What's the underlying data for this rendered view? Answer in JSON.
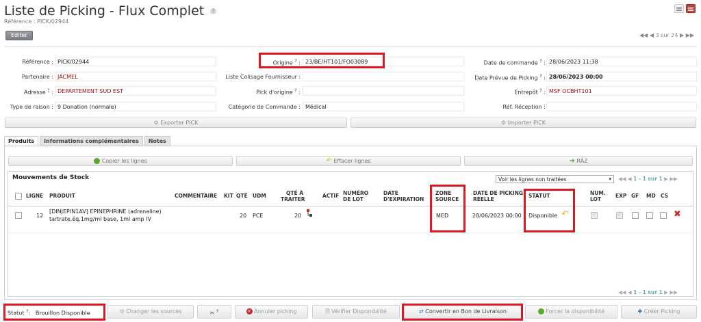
{
  "header": {
    "title": "Liste de Picking - Flux Complet",
    "title_help": "?",
    "reference_line": "Référence : PICK/02944",
    "edit_label": "Editer",
    "pager": "◀◀ ◀ 3 sur 24 ▶ ▶▶"
  },
  "form": {
    "reference": {
      "label": "Référence :",
      "value": "PICK/02944"
    },
    "partenaire": {
      "label": "Partenaire :",
      "value": "JACMEL"
    },
    "adresse": {
      "label": "Adresse",
      "help": "?",
      "sep": ":",
      "value": "DEPARTEMENT SUD EST"
    },
    "type_raison": {
      "label": "Type de raison :",
      "value": "9 Donation (normale)"
    },
    "origine": {
      "label": "Origine",
      "help": "?",
      "sep": ":",
      "value": "23/BE/HT101/FO03089"
    },
    "colisage": {
      "label": "Liste Colisage Fournisseur :",
      "value": ""
    },
    "pick_origine": {
      "label": "Pick d'origine",
      "help": "?",
      "sep": ":",
      "value": ""
    },
    "categorie": {
      "label": "Catégorie de Commande :",
      "value": "Médical"
    },
    "date_commande": {
      "label": "Date de commande",
      "help": "?",
      "sep": ":",
      "value": "28/06/2023 11:38"
    },
    "date_prevue": {
      "label": "Date Prévue de Picking",
      "help": "?",
      "sep": ":",
      "value": "28/06/2023 00:00"
    },
    "entrepot": {
      "label": "Entrepôt",
      "help": "?",
      "sep": ":",
      "value": "MSF OCBHT101"
    },
    "ref_reception": {
      "label": "Réf. Réception :",
      "value": ""
    }
  },
  "exports": {
    "export": "Exporter PICK",
    "import": "Importer PICK"
  },
  "tabs": [
    "Produits",
    "Informations complémentaires",
    "Notes"
  ],
  "actions": {
    "copy": "Copier les lignes",
    "clear": "Effacer lignes",
    "raz": "RÀZ"
  },
  "grid": {
    "title": "Mouvements de Stock",
    "filter": "Voir les lignes non traitées",
    "pager": "1 - 1 sur 1",
    "columns": [
      "LIGNE",
      "PRODUIT",
      "COMMENTAIRE",
      "KIT",
      "QTÉ",
      "UDM",
      "QTÉ À",
      "TRAITER",
      "ACTIF",
      "NUMÉRO",
      "DE LOT",
      "DATE",
      "D'EXPIRATION",
      "ZONE",
      "SOURCE",
      "DATE DE PICKING",
      "RÉELLE",
      "STATUT",
      "NUM.",
      "LOT",
      "EXP",
      "GF",
      "MD",
      "CS"
    ],
    "rows": [
      {
        "ligne": "12",
        "produit_1": "[DINJEPIN1AV] EPINEPHRINE (adrenaline)",
        "produit_2": "tartrate,éq.1mg/ml base, 1ml amp IV",
        "qte": "20",
        "udm": "PCE",
        "qte_traiter": "20",
        "zone_source": "MED",
        "date_picking": "28/06/2023 00:00",
        "statut": "Disponible"
      }
    ]
  },
  "bottom": {
    "statut_label": "Statut",
    "statut_help": "?",
    "statut_sep": ":",
    "statut_value_1": "Brouillon",
    "statut_value_2": "Disponible",
    "changer_sources": "Changer les sources",
    "help_btn": "?",
    "annuler": "Annuler picking",
    "verifier": "Vérifier Disponibilité",
    "convertir": "Convertir en Bon de Livraison",
    "forcer": "Forcer la disponibilité",
    "creer": "Créer Picking"
  },
  "colors": {
    "highlight": "#e0161e",
    "red_text": "#a40e0e",
    "help_green": "#5a9a2a"
  }
}
